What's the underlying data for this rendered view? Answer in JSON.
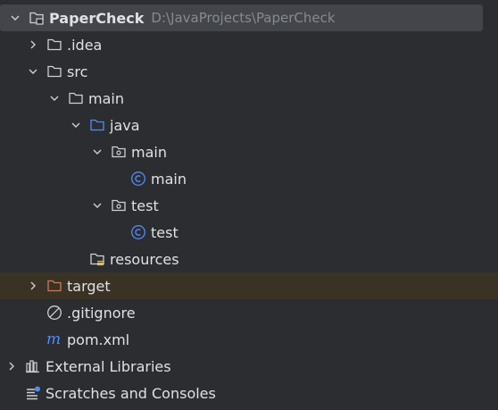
{
  "tree": {
    "root": {
      "label": "PaperCheck",
      "path": "D:\\JavaProjects\\PaperCheck",
      "icon": "module-folder-icon"
    },
    "idea": {
      "label": ".idea",
      "icon": "folder-icon"
    },
    "src": {
      "label": "src",
      "icon": "folder-icon"
    },
    "main": {
      "label": "main",
      "icon": "folder-icon"
    },
    "java": {
      "label": "java",
      "icon": "source-root-folder-icon"
    },
    "pkg_main": {
      "label": "main",
      "icon": "package-icon"
    },
    "cls_main": {
      "label": "main",
      "icon": "class-icon"
    },
    "pkg_test": {
      "label": "test",
      "icon": "package-icon"
    },
    "cls_test": {
      "label": "test",
      "icon": "class-icon"
    },
    "resources": {
      "label": "resources",
      "icon": "resources-folder-icon"
    },
    "target": {
      "label": "target",
      "icon": "excluded-folder-icon"
    },
    "gitignore": {
      "label": ".gitignore",
      "icon": "ignore-file-icon"
    },
    "pom": {
      "label": "pom.xml",
      "icon": "maven-icon"
    },
    "libraries": {
      "label": "External Libraries",
      "icon": "library-icon"
    },
    "scratches": {
      "label": "Scratches and Consoles",
      "icon": "scratches-icon"
    }
  },
  "colors": {
    "background": "#2b2d30",
    "selection": "#43454a",
    "excluded_row": "#3b3226",
    "text": "#dfe1e5",
    "path_text": "#868a91",
    "source_blue": "#548af7",
    "excluded_orange": "#c77d55"
  }
}
